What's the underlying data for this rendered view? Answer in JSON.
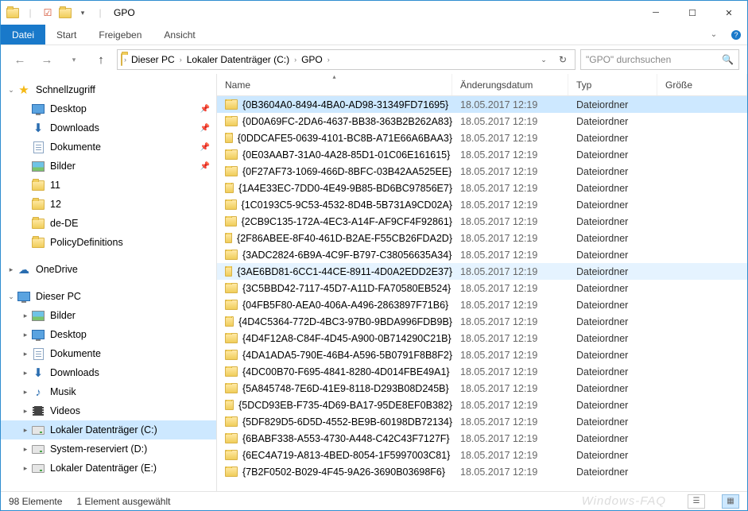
{
  "window": {
    "title": "GPO"
  },
  "ribbon": {
    "file": "Datei",
    "tabs": [
      "Start",
      "Freigeben",
      "Ansicht"
    ]
  },
  "breadcrumb": [
    "Dieser PC",
    "Lokaler Datenträger (C:)",
    "GPO"
  ],
  "search": {
    "placeholder": "\"GPO\" durchsuchen"
  },
  "columns": {
    "name": "Name",
    "date": "Änderungsdatum",
    "type": "Typ",
    "size": "Größe"
  },
  "sidebar": {
    "quick": {
      "label": "Schnellzugriff",
      "items": [
        {
          "label": "Desktop",
          "icon": "monitor",
          "pinned": true
        },
        {
          "label": "Downloads",
          "icon": "download",
          "pinned": true
        },
        {
          "label": "Dokumente",
          "icon": "doc",
          "pinned": true
        },
        {
          "label": "Bilder",
          "icon": "picture",
          "pinned": true
        },
        {
          "label": "11",
          "icon": "folder",
          "pinned": false
        },
        {
          "label": "12",
          "icon": "folder",
          "pinned": false
        },
        {
          "label": "de-DE",
          "icon": "folder",
          "pinned": false
        },
        {
          "label": "PolicyDefinitions",
          "icon": "folder",
          "pinned": false
        }
      ]
    },
    "onedrive": {
      "label": "OneDrive"
    },
    "thispc": {
      "label": "Dieser PC",
      "items": [
        {
          "label": "Bilder",
          "icon": "picture"
        },
        {
          "label": "Desktop",
          "icon": "monitor"
        },
        {
          "label": "Dokumente",
          "icon": "doc"
        },
        {
          "label": "Downloads",
          "icon": "download"
        },
        {
          "label": "Musik",
          "icon": "music"
        },
        {
          "label": "Videos",
          "icon": "video"
        },
        {
          "label": "Lokaler Datenträger (C:)",
          "icon": "drive",
          "selected": true
        },
        {
          "label": "System-reserviert (D:)",
          "icon": "drive"
        },
        {
          "label": "Lokaler Datenträger (E:)",
          "icon": "drive"
        }
      ]
    }
  },
  "files": [
    {
      "name": "{0B3604A0-8494-4BA0-AD98-31349FD71695}",
      "date": "18.05.2017 12:19",
      "type": "Dateiordner",
      "selected": true
    },
    {
      "name": "{0D0A69FC-2DA6-4637-BB38-363B2B262A83}",
      "date": "18.05.2017 12:19",
      "type": "Dateiordner"
    },
    {
      "name": "{0DDCAFE5-0639-4101-BC8B-A71E66A6BAA3}",
      "date": "18.05.2017 12:19",
      "type": "Dateiordner"
    },
    {
      "name": "{0E03AAB7-31A0-4A28-85D1-01C06E161615}",
      "date": "18.05.2017 12:19",
      "type": "Dateiordner"
    },
    {
      "name": "{0F27AF73-1069-466D-8BFC-03B42AA525EE}",
      "date": "18.05.2017 12:19",
      "type": "Dateiordner"
    },
    {
      "name": "{1A4E33EC-7DD0-4E49-9B85-BD6BC97856E7}",
      "date": "18.05.2017 12:19",
      "type": "Dateiordner"
    },
    {
      "name": "{1C0193C5-9C53-4532-8D4B-5B731A9CD02A}",
      "date": "18.05.2017 12:19",
      "type": "Dateiordner"
    },
    {
      "name": "{2CB9C135-172A-4EC3-A14F-AF9CF4F92861}",
      "date": "18.05.2017 12:19",
      "type": "Dateiordner"
    },
    {
      "name": "{2F86ABEE-8F40-461D-B2AE-F55CB26FDA2D}",
      "date": "18.05.2017 12:19",
      "type": "Dateiordner"
    },
    {
      "name": "{3ADC2824-6B9A-4C9F-B797-C38056635A34}",
      "date": "18.05.2017 12:19",
      "type": "Dateiordner"
    },
    {
      "name": "{3AE6BD81-6CC1-44CE-8911-4D0A2EDD2E37}",
      "date": "18.05.2017 12:19",
      "type": "Dateiordner",
      "hover": true
    },
    {
      "name": "{3C5BBD42-7117-45D7-A11D-FA70580EB524}",
      "date": "18.05.2017 12:19",
      "type": "Dateiordner"
    },
    {
      "name": "{04FB5F80-AEA0-406A-A496-2863897F71B6}",
      "date": "18.05.2017 12:19",
      "type": "Dateiordner"
    },
    {
      "name": "{4D4C5364-772D-4BC3-97B0-9BDA996FDB9B}",
      "date": "18.05.2017 12:19",
      "type": "Dateiordner"
    },
    {
      "name": "{4D4F12A8-C84F-4D45-A900-0B714290C21B}",
      "date": "18.05.2017 12:19",
      "type": "Dateiordner"
    },
    {
      "name": "{4DA1ADA5-790E-46B4-A596-5B0791F8B8F2}",
      "date": "18.05.2017 12:19",
      "type": "Dateiordner"
    },
    {
      "name": "{4DC00B70-F695-4841-8280-4D014FBE49A1}",
      "date": "18.05.2017 12:19",
      "type": "Dateiordner"
    },
    {
      "name": "{5A845748-7E6D-41E9-8118-D293B08D245B}",
      "date": "18.05.2017 12:19",
      "type": "Dateiordner"
    },
    {
      "name": "{5DCD93EB-F735-4D69-BA17-95DE8EF0B382}",
      "date": "18.05.2017 12:19",
      "type": "Dateiordner"
    },
    {
      "name": "{5DF829D5-6D5D-4552-BE9B-60198DB72134}",
      "date": "18.05.2017 12:19",
      "type": "Dateiordner"
    },
    {
      "name": "{6BABF338-A553-4730-A448-C42C43F7127F}",
      "date": "18.05.2017 12:19",
      "type": "Dateiordner"
    },
    {
      "name": "{6EC4A719-A813-4BED-8054-1F5997003C81}",
      "date": "18.05.2017 12:19",
      "type": "Dateiordner"
    },
    {
      "name": "{7B2F0502-B029-4F45-9A26-3690B03698F6}",
      "date": "18.05.2017 12:19",
      "type": "Dateiordner"
    }
  ],
  "status": {
    "count": "98 Elemente",
    "selected": "1 Element ausgewählt",
    "watermark": "Windows-FAQ"
  }
}
